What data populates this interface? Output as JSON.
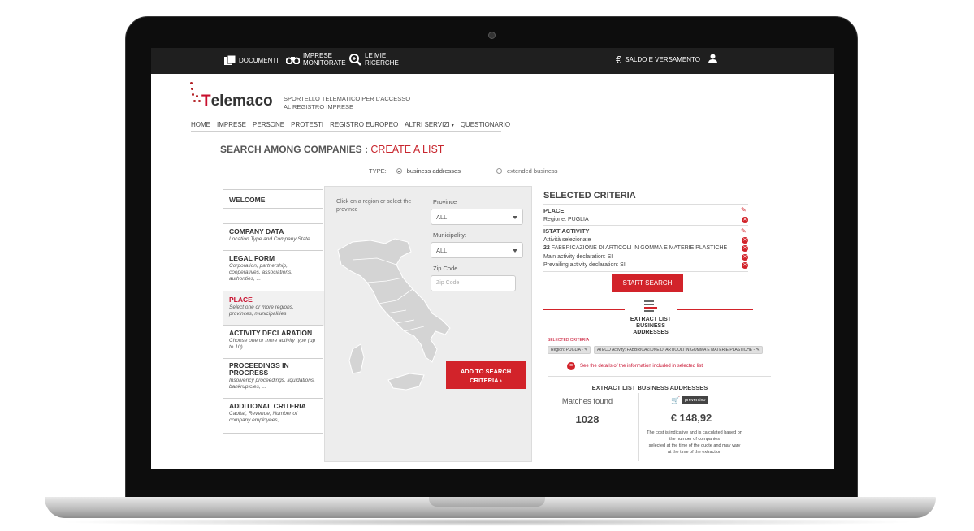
{
  "topbar": {
    "documents": "DOCUMENTI",
    "monitored_line1": "IMPRESE",
    "monitored_line2": "MONITORATE",
    "searches_line1": "LE MIE",
    "searches_line2": "RICERCHE",
    "balance": "SALDO E VERSAMENTO"
  },
  "brand": {
    "logo_text_t": "T",
    "logo_text_rest": "elemaco",
    "tagline_line1": "SPORTELLO TELEMATICO PER L'ACCESSO",
    "tagline_line2": "AL REGISTRO IMPRESE"
  },
  "nav": [
    "HOME",
    "IMPRESE",
    "PERSONE",
    "PROTESTI",
    "REGISTRO EUROPEO",
    "ALTRI SERVIZI",
    "QUESTIONARIO"
  ],
  "page": {
    "title": "SEARCH AMONG COMPANIES : ",
    "subtitle": "CREATE A LIST",
    "type_label": "TYPE:",
    "type_option_1": "business addresses",
    "type_option_2": "extended business"
  },
  "tabs": [
    {
      "title": "WELCOME",
      "desc": ""
    },
    {
      "title": "COMPANY DATA",
      "desc": "Location Type and Company State"
    },
    {
      "title": "LEGAL FORM",
      "desc": "Corporation, partnership, cooperatives, associations, authorities, ..."
    },
    {
      "title": "PLACE",
      "desc": "Select one or more regions, provinces, municipalities"
    },
    {
      "title": "ACTIVITY DECLARATION",
      "desc": "Choose one or more activity type (up to 10)"
    },
    {
      "title": "PROCEEDINGS IN PROGRESS",
      "desc": "Insolvency proceedings, liquidations, bankruptcies, ..."
    },
    {
      "title": "ADDITIONAL CRITERIA",
      "desc": "Capital, Revenue, Number of company employees, ..."
    }
  ],
  "place_panel": {
    "hint": "Click on a region or select the province",
    "province_label": "Province",
    "province_value": "ALL",
    "municipality_label": "Municipality:",
    "municipality_value": "ALL",
    "zip_label": "Zip Code",
    "zip_placeholder": "Zip Code",
    "add_button_line1": "ADD TO SEARCH",
    "add_button_line2": "CRITERIA"
  },
  "criteria": {
    "title": "SELECTED CRITERIA",
    "place_heading": "PLACE",
    "place_region_label": "Regione: ",
    "place_region_value": "PUGLIA",
    "istat_heading": "ISTAT ACTIVITY",
    "istat_selected": "Attività selezionate",
    "istat_code": "22",
    "istat_desc": "FABBRICAZIONE DI ARTICOLI IN GOMMA E MATERIE PLASTICHE",
    "main_decl": "Main activity declaration: SI",
    "prevailing_decl": "Prevailing activity declaration: SI",
    "start_button": "START SEARCH"
  },
  "extract": {
    "label_line1": "EXTRACT LIST",
    "label_line2": "BUSINESS",
    "label_line3": "ADDRESSES",
    "selected_criteria": "SELECTED CRITERIA",
    "chip1": "Region: PUGLIA -",
    "chip2": "ATECO Activity: FABBRICAZIONE DI ARTICOLI IN GOMMA E MATERIE PLASTICHE -",
    "details_link": "See the details of the information included in selected list",
    "section_title": "EXTRACT LIST BUSINESS ADDRESSES",
    "matches_label": "Matches found",
    "matches_value": "1028",
    "quote_badge": "preventivo",
    "price": "€ 148,92",
    "cost_note_1": "The cost is indicative and is calculated based on",
    "cost_note_2": "the number of companies",
    "cost_note_3": "selected at the time of the quote and may vary",
    "cost_note_4": "at the time of the extraction"
  },
  "colors": {
    "accent": "#d2232a",
    "topbar": "#1f1f1f"
  }
}
